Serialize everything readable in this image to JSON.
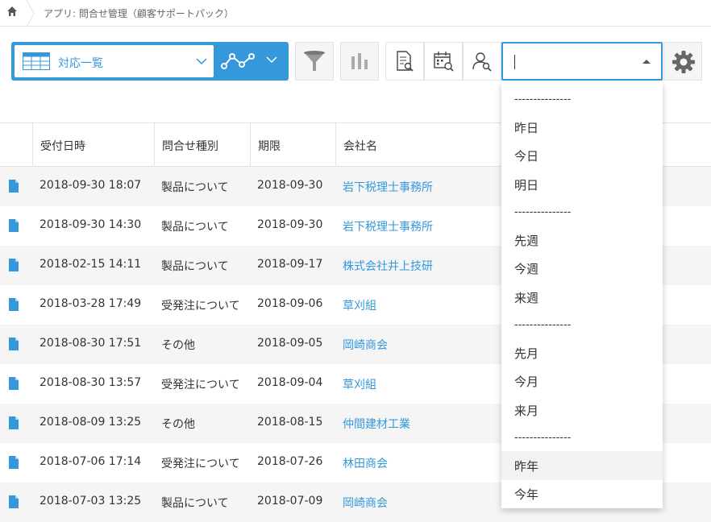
{
  "breadcrumb": {
    "app": "アプリ: 問合せ管理（顧客サポートパック）"
  },
  "toolbar": {
    "view_label": "対応一覧"
  },
  "date_input": {
    "value": ""
  },
  "columns": [
    "受付日時",
    "問合せ種別",
    "期限",
    "会社名"
  ],
  "rows": [
    {
      "received": "2018-09-30 18:07",
      "type": "製品について",
      "due": "2018-09-30",
      "company": "岩下税理士事務所"
    },
    {
      "received": "2018-09-30 14:30",
      "type": "製品について",
      "due": "2018-09-30",
      "company": "岩下税理士事務所"
    },
    {
      "received": "2018-02-15 14:11",
      "type": "製品について",
      "due": "2018-09-17",
      "company": "株式会社井上技研"
    },
    {
      "received": "2018-03-28 17:49",
      "type": "受発注について",
      "due": "2018-09-06",
      "company": "草刈組"
    },
    {
      "received": "2018-08-30 17:51",
      "type": "その他",
      "due": "2018-09-05",
      "company": "岡崎商会"
    },
    {
      "received": "2018-08-30 13:57",
      "type": "受発注について",
      "due": "2018-09-04",
      "company": "草刈組"
    },
    {
      "received": "2018-08-09 13:25",
      "type": "その他",
      "due": "2018-08-15",
      "company": "仲間建材工業"
    },
    {
      "received": "2018-07-06 17:14",
      "type": "受発注について",
      "due": "2018-07-26",
      "company": "林田商会"
    },
    {
      "received": "2018-07-03 13:25",
      "type": "製品について",
      "due": "2018-07-09",
      "company": "岡崎商会"
    }
  ],
  "dropdown": {
    "items": [
      "---------------",
      "昨日",
      "今日",
      "明日",
      "---------------",
      "先週",
      "今週",
      "来週",
      "---------------",
      "先月",
      "今月",
      "来月",
      "---------------",
      "昨年",
      "今年"
    ]
  },
  "colors": {
    "accent": "#3498db",
    "row_alt": "#f5f5f5",
    "border": "#e3e3e3"
  }
}
